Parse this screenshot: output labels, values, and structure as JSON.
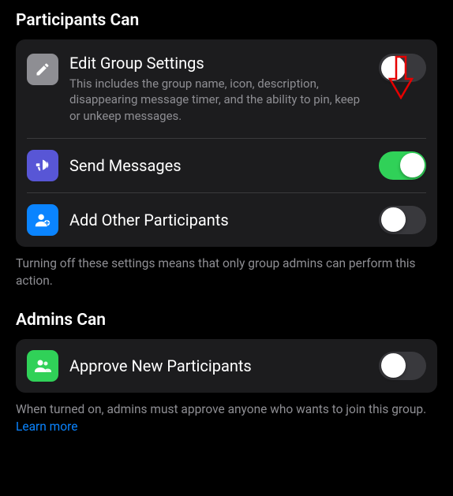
{
  "sections": {
    "participants": {
      "title": "Participants Can",
      "items": [
        {
          "label": "Edit Group Settings",
          "description": "This includes the group name, icon, description, disappearing message timer, and the ability to pin, keep or unkeep messages.",
          "toggle": false,
          "icon_name": "pencil-icon",
          "tile_color": "gray"
        },
        {
          "label": "Send Messages",
          "toggle": true,
          "icon_name": "megaphone-icon",
          "tile_color": "purple"
        },
        {
          "label": "Add Other Participants",
          "toggle": false,
          "icon_name": "person-add-icon",
          "tile_color": "blue"
        }
      ],
      "footer": "Turning off these settings means that only group admins can perform this action."
    },
    "admins": {
      "title": "Admins Can",
      "items": [
        {
          "label": "Approve New Participants",
          "toggle": false,
          "icon_name": "people-approve-icon",
          "tile_color": "green"
        }
      ],
      "footer_prefix": "When turned on, admins must approve anyone who wants to join this group. ",
      "footer_link": "Learn more"
    }
  },
  "annotation": {
    "arrow_color": "#e60000"
  }
}
